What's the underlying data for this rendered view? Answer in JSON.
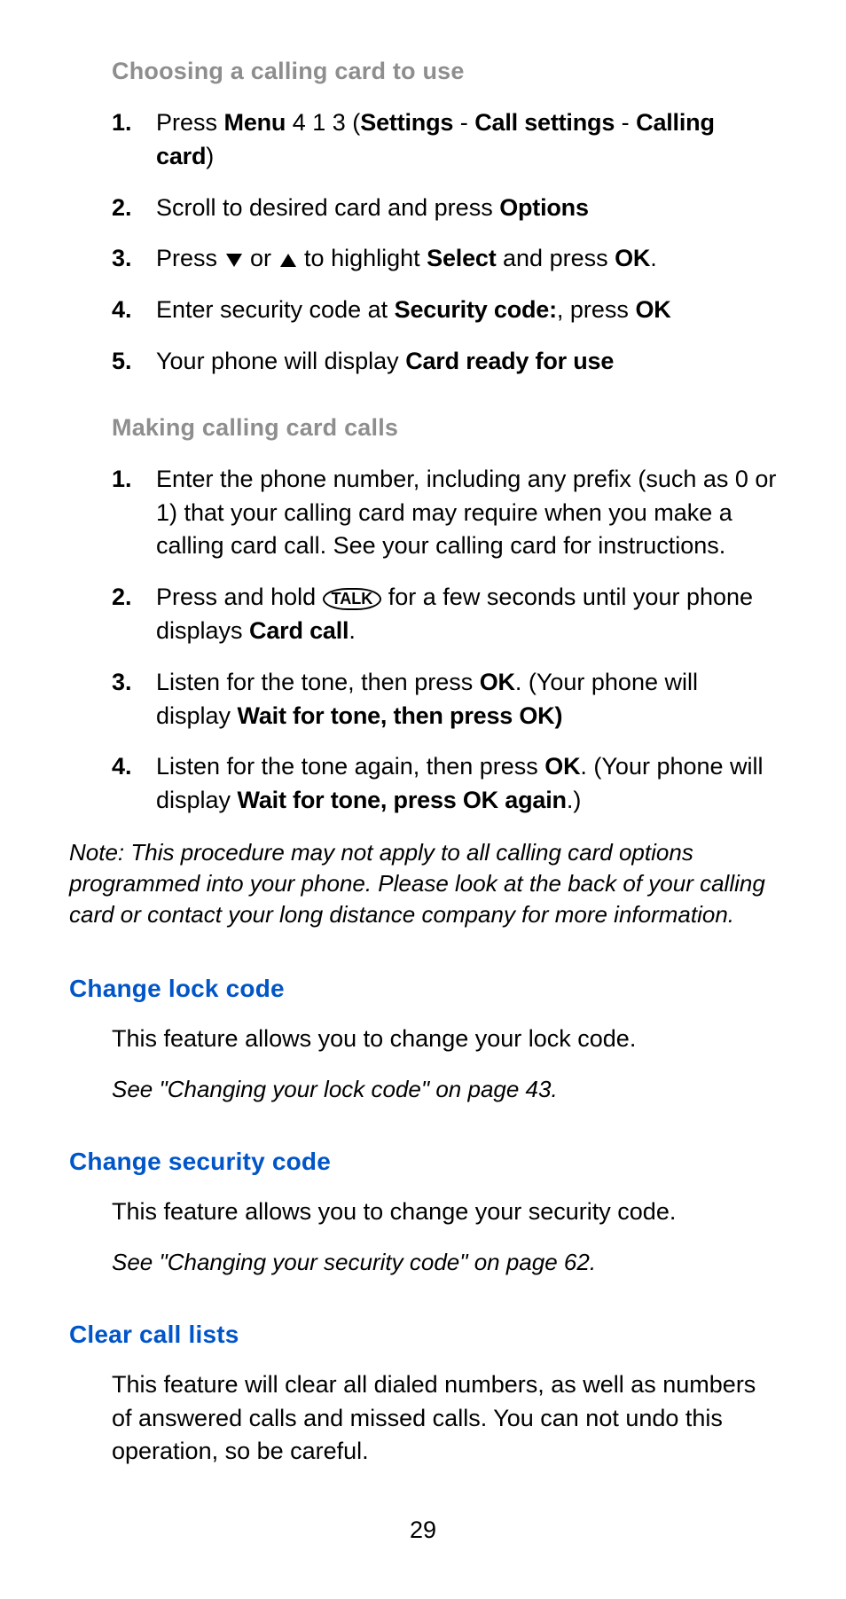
{
  "headings": {
    "choosing": "Choosing a calling card to use",
    "making": "Making calling card calls",
    "change_lock": "Change lock code",
    "change_security": "Change security code",
    "clear_call": "Clear call lists"
  },
  "choosing_steps": {
    "s1_pre": "Press ",
    "s1_menu": "Menu",
    "s1_mid": " 4 1 3 (",
    "s1_settings": "Settings",
    "s1_dash1": " - ",
    "s1_call_settings": "Call settings",
    "s1_dash2": " - ",
    "s1_calling_card": "Calling card",
    "s1_end": ")",
    "s2_pre": "Scroll to desired card and press ",
    "s2_options": "Options",
    "s3_pre": "Press ",
    "s3_mid": " or ",
    "s3_after": " to highlight ",
    "s3_select": "Select",
    "s3_and": " and press ",
    "s3_ok": "OK",
    "s3_end": ".",
    "s4_pre": "Enter security code at ",
    "s4_sec": "Security code:",
    "s4_mid": ", press ",
    "s4_ok": "OK",
    "s5_pre": "Your phone will display ",
    "s5_card": "Card ready for use"
  },
  "making_steps": {
    "s1": "Enter the phone number, including any prefix (such as 0 or 1) that your calling card may require when you make a calling card call. See your calling card for instructions.",
    "s2_pre": "Press and hold ",
    "s2_talk": "TALK",
    "s2_mid": " for a few seconds until your phone displays ",
    "s2_card_call": "Card call",
    "s2_end": ".",
    "s3_pre": "Listen for the tone, then press ",
    "s3_ok": "OK",
    "s3_mid": ". (Your phone will display ",
    "s3_wait": "Wait for tone, then press OK)",
    "s4_pre": "Listen for the tone again, then press ",
    "s4_ok": "OK",
    "s4_mid": ". (Your phone will display ",
    "s4_wait": "Wait for tone, press OK again",
    "s4_end": ".)"
  },
  "note": "Note: This procedure may not apply to all calling card options programmed into your phone. Please look at the back of your calling card or contact your long distance company for more information.",
  "change_lock": {
    "body": "This feature allows you to change your lock code.",
    "xref": "See \"Changing your lock code\" on page 43."
  },
  "change_security": {
    "body": "This feature allows you to change your security code.",
    "xref": "See \"Changing your security code\" on page 62."
  },
  "clear_call": {
    "body": "This feature will clear all dialed numbers, as well as numbers of answered calls and missed calls. You can not undo this operation, so be careful."
  },
  "nums": {
    "n1": "1.",
    "n2": "2.",
    "n3": "3.",
    "n4": "4.",
    "n5": "5."
  },
  "page_number": "29"
}
